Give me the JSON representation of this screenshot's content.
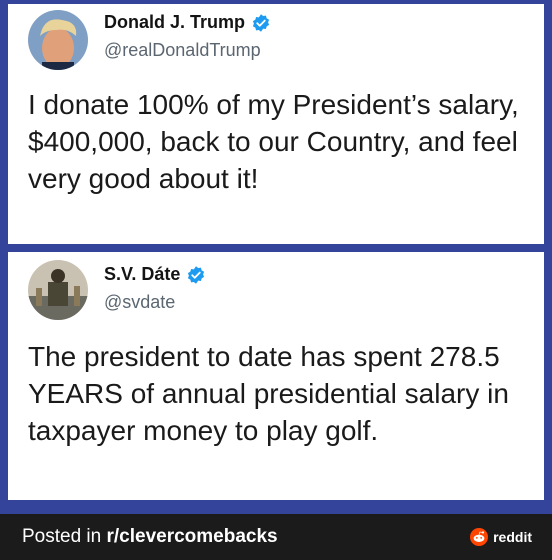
{
  "tweets": [
    {
      "name": "Donald J. Trump",
      "handle": "@realDonaldTrump",
      "text": "I donate 100% of my President’s salary, $400,000, back to our Country, and feel very good about it!",
      "verified": true
    },
    {
      "name": "S.V. Dáte",
      "handle": "@svdate",
      "text": "The president to date has spent 278.5 YEARS of annual presidential salary in taxpayer money to play golf.",
      "verified": true
    }
  ],
  "footer": {
    "posted_prefix": "Posted in ",
    "subreddit": "r/clevercomebacks",
    "brand": "reddit"
  },
  "colors": {
    "background": "#34449a",
    "verified_blue": "#1d9bf0",
    "footer_bg": "#1b1b1b",
    "reddit_orange": "#ff4500"
  }
}
